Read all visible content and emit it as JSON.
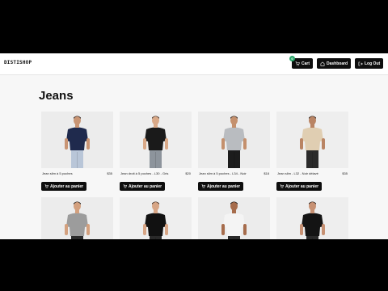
{
  "header": {
    "logo_text": "DISTISHOP",
    "cart_label": "Cart",
    "cart_count": "0",
    "dashboard_label": "Dashboard",
    "logout_label": "Log Out"
  },
  "page": {
    "title": "Jeans"
  },
  "products": [
    {
      "name": "Jean slim à 5 poches",
      "price": "$35",
      "button": "Ajouter au panier",
      "shirt_color": "#1f2a4d",
      "pants_color": "#b9c6d8",
      "skin": "#c99574",
      "hair": "#2b2220",
      "bg": "#ececec"
    },
    {
      "name": "Jean droit à 5 poches - L30 - Gris",
      "price": "$20",
      "button": "Ajouter au panier",
      "shirt_color": "#1a1a1a",
      "pants_color": "#8d949c",
      "skin": "#d9a988",
      "hair": "#3a2a22",
      "bg": "#eeeeee"
    },
    {
      "name": "Jean slim à 5 poches - L34 - Noir",
      "price": "$18",
      "button": "Ajouter au panier",
      "shirt_color": "#b9bcc0",
      "pants_color": "#1c1c1c",
      "skin": "#c4906d",
      "hair": "#2a201c",
      "bg": "#ececec"
    },
    {
      "name": "Jean slim - L32 - Noir délavé",
      "price": "$35",
      "button": "Ajouter au panier",
      "shirt_color": "#e0ceb2",
      "pants_color": "#2a2a2a",
      "skin": "#b98464",
      "hair": "#2a201c",
      "bg": "#eeeeee"
    },
    {
      "name": "",
      "price": "",
      "button": "",
      "shirt_color": "#9c9c9c",
      "pants_color": "#2a2a2a",
      "skin": "#d3a07e",
      "hair": "#1d1d1d",
      "bg": "#ececec"
    },
    {
      "name": "",
      "price": "",
      "button": "",
      "shirt_color": "#111111",
      "pants_color": "#2a2a2a",
      "skin": "#d7a585",
      "hair": "#3a2a22",
      "bg": "#eeeeee"
    },
    {
      "name": "",
      "price": "",
      "button": "",
      "shirt_color": "#f4f4f4",
      "pants_color": "#2a2a2a",
      "skin": "#a66c4c",
      "hair": "#1d1d1d",
      "bg": "#ececec"
    },
    {
      "name": "",
      "price": "",
      "button": "",
      "shirt_color": "#141414",
      "pants_color": "#2a2a2a",
      "skin": "#c79173",
      "hair": "#2a201c",
      "bg": "#eeeeee"
    }
  ]
}
